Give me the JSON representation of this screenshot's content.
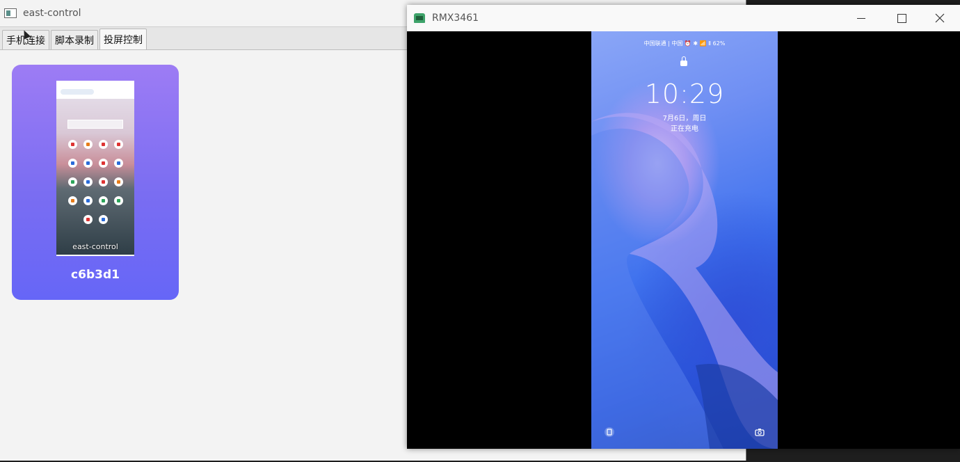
{
  "app": {
    "title": "east-control",
    "tabs": [
      "手机连接",
      "脚本录制",
      "投屏控制"
    ],
    "device_card": {
      "thumbnail_label": "east-control",
      "device_name": "c6b3d1"
    }
  },
  "mirror": {
    "title": "RMX3461",
    "phone": {
      "status_bar": "中国联通 | 中国  ⏰ ✱ 📶 Ⅱ 62%",
      "time": "10:29",
      "date": "7月6日，周日",
      "charging": "正在充电"
    }
  },
  "colors": {
    "card_top": "#9d7cf4",
    "card_bottom": "#6666f7"
  }
}
